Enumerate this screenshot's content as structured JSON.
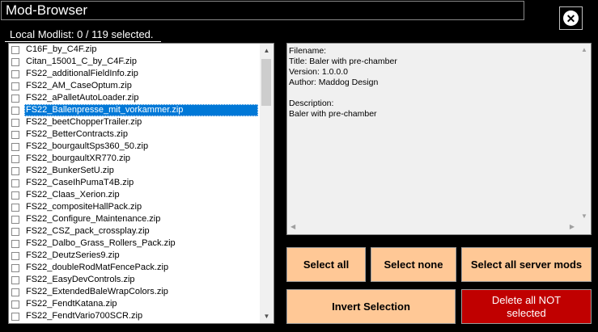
{
  "window": {
    "title": "Mod-Browser",
    "close_icon": "close-circle-icon"
  },
  "modlist": {
    "label": "Local Modlist: 0 / 119 selected.",
    "items": [
      "C16F_by_C4F.zip",
      "Citan_15001_C_by_C4F.zip",
      "FS22_additionalFieldInfo.zip",
      "FS22_AM_CaseOptum.zip",
      "FS22_aPalletAutoLoader.zip",
      "FS22_Ballenpresse_mit_vorkammer.zip",
      "FS22_beetChopperTrailer.zip",
      "FS22_BetterContracts.zip",
      "FS22_bourgaultSps360_50.zip",
      "FS22_bourgaultXR770.zip",
      "FS22_BunkerSetU.zip",
      "FS22_CaseIhPumaT4B.zip",
      "FS22_Claas_Xerion.zip",
      "FS22_compositeHallPack.zip",
      "FS22_Configure_Maintenance.zip",
      "FS22_CSZ_pack_crossplay.zip",
      "FS22_Dalbo_Grass_Rollers_Pack.zip",
      "FS22_DeutzSeries9.zip",
      "FS22_doubleRodMatFencePack.zip",
      "FS22_EasyDevControls.zip",
      "FS22_ExtendedBaleWrapColors.zip",
      "FS22_FendtKatana.zip",
      "FS22_FendtVario700SCR.zip"
    ],
    "selected_index": 5
  },
  "info": {
    "text": "Filename:\nTitle: Baler with pre-chamber\nVersion: 1.0.0.0\nAuthor: Maddog Design\n\nDescription:\nBaler with pre-chamber"
  },
  "buttons": {
    "select_all": "Select all",
    "select_none": "Select none",
    "select_server": "Select all server mods",
    "invert": "Invert Selection",
    "delete_not_selected": "Delete all NOT selected"
  },
  "colors": {
    "button_bg": "#ffc896",
    "delete_bg": "#c00000",
    "selection": "#0078d7"
  }
}
